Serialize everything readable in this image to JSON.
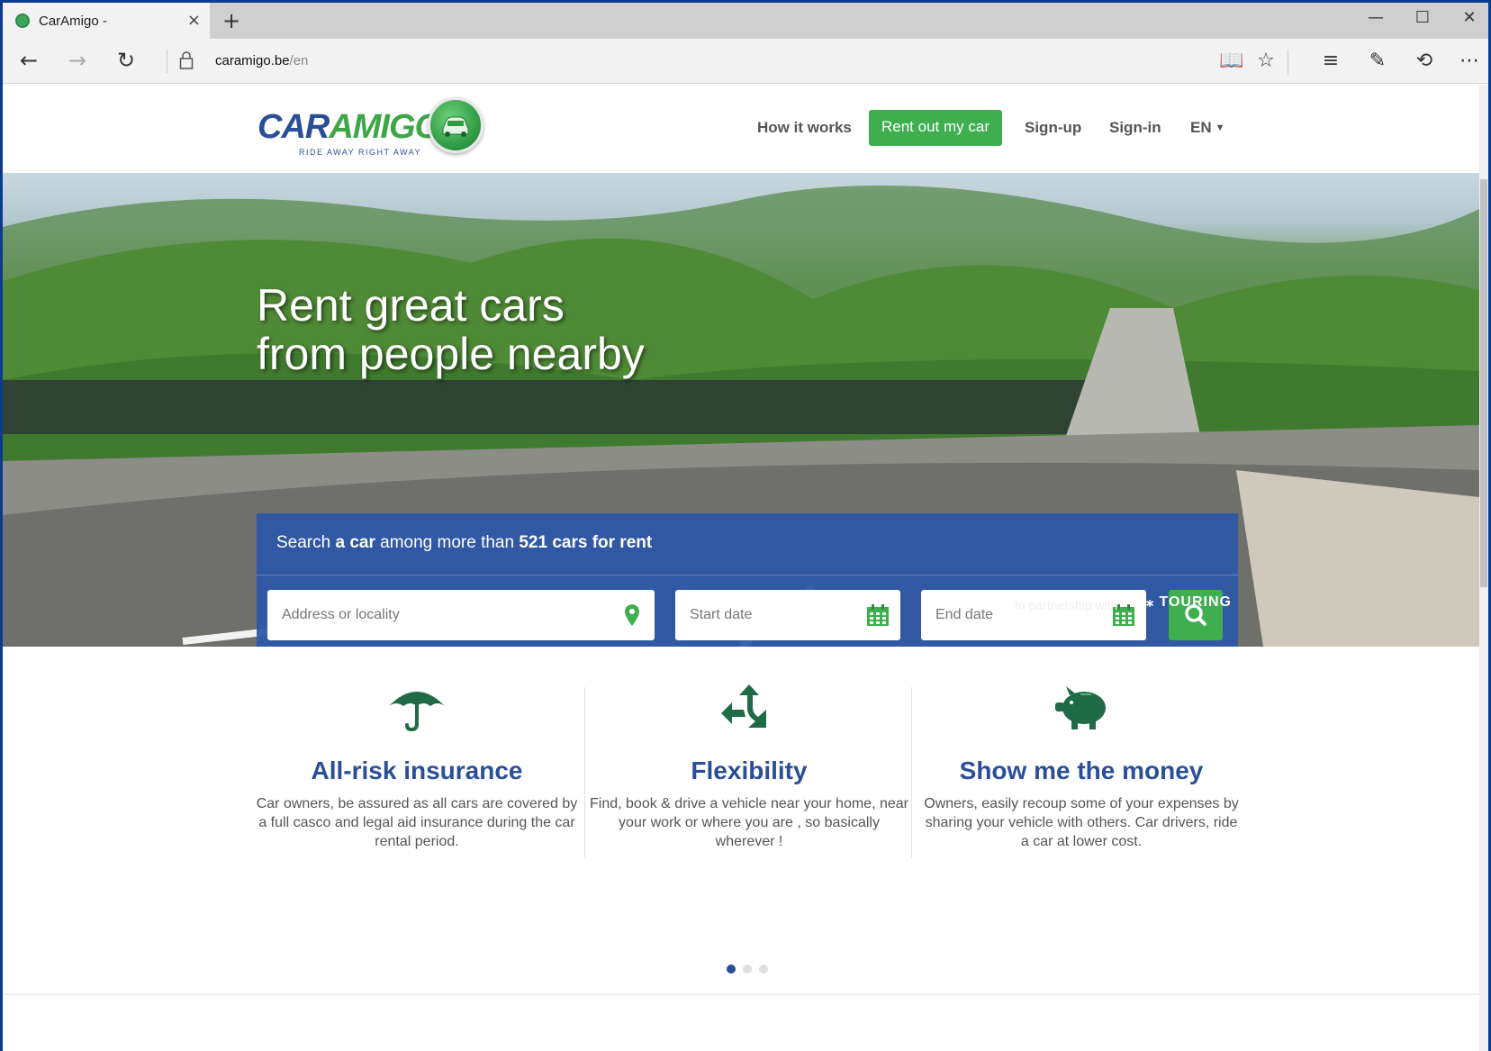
{
  "browser": {
    "tab_title": "CarAmigo -",
    "tab_close": "×",
    "new_tab": "+",
    "url_host": "caramigo.be",
    "url_path": "/en",
    "window_controls": {
      "minimize": "—",
      "maximize": "☐",
      "close": "✕"
    }
  },
  "header": {
    "logo_word_a": "CAR",
    "logo_word_b": "AMIGO",
    "logo_tagline": "RIDE AWAY RIGHT AWAY",
    "nav": {
      "how_it_works": "How it works",
      "rent_out": "Rent out my car",
      "signup": "Sign-up",
      "signin": "Sign-in",
      "language": "EN"
    }
  },
  "hero": {
    "title_line1": "Rent great cars",
    "title_line2": "from people nearby",
    "search": {
      "headline_prefix": "Search ",
      "headline_bold1": "a car",
      "headline_mid": " among more than ",
      "headline_bold2": "521 cars for rent",
      "address_placeholder": "Address or locality",
      "start_placeholder": "Start date",
      "end_placeholder": "End date"
    },
    "partner_text": "In partnership with",
    "partner_name": "TOURING"
  },
  "features": [
    {
      "title": "All-risk insurance",
      "text": "Car owners, be assured as all cars are covered by a full casco and legal aid insurance during the car rental period.",
      "icon": "umbrella-icon"
    },
    {
      "title": "Flexibility",
      "text": "Find, book & drive a vehicle near your home, near your work or where you are , so basically wherever !",
      "icon": "split-arrows-icon"
    },
    {
      "title": "Show me the money",
      "text": "Owners, easily recoup some of your expenses by sharing your vehicle with others. Car drivers, ride a car at lower cost.",
      "icon": "piggy-bank-icon"
    }
  ],
  "carousel": {
    "pages": 3,
    "active": 1
  },
  "colors": {
    "brand_blue": "#2a4f97",
    "brand_green": "#3fae4e",
    "search_panel": "#2c56a8"
  }
}
